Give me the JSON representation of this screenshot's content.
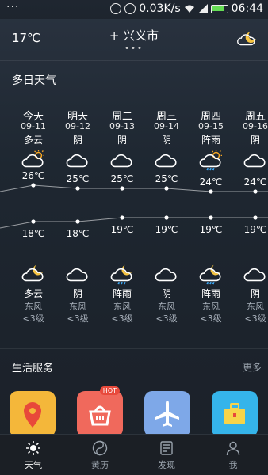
{
  "statusbar": {
    "menu_dots": "···",
    "net_speed": "0.03K/s",
    "time": "06:44"
  },
  "header": {
    "current_temp": "17℃",
    "city": "+ 兴义市",
    "page_dots": "•••"
  },
  "forecast_section": {
    "title": "多日天气"
  },
  "days": [
    {
      "name": "今天",
      "date": "09-11",
      "day_cond": "多云",
      "day_icon": "partly-cloudy-sun-icon",
      "high": "26℃",
      "low": "18℃",
      "night_icon": "cloud-moon-icon",
      "night_cond": "多云",
      "wind_dir": "东风",
      "wind_level": "<3级"
    },
    {
      "name": "明天",
      "date": "09-12",
      "day_cond": "阴",
      "day_icon": "cloud-icon",
      "high": "25℃",
      "low": "18℃",
      "night_icon": "cloud-icon",
      "night_cond": "阴",
      "wind_dir": "东风",
      "wind_level": "<3级"
    },
    {
      "name": "周二",
      "date": "09-13",
      "day_cond": "阴",
      "day_icon": "cloud-icon",
      "high": "25℃",
      "low": "19℃",
      "night_icon": "rain-moon-icon",
      "night_cond": "阵雨",
      "wind_dir": "东风",
      "wind_level": "<3级"
    },
    {
      "name": "周三",
      "date": "09-14",
      "day_cond": "阴",
      "day_icon": "cloud-icon",
      "high": "25℃",
      "low": "19℃",
      "night_icon": "cloud-icon",
      "night_cond": "阴",
      "wind_dir": "东风",
      "wind_level": "<3级"
    },
    {
      "name": "周四",
      "date": "09-15",
      "day_cond": "阵雨",
      "day_icon": "rain-sun-icon",
      "high": "24℃",
      "low": "19℃",
      "night_icon": "rain-moon-icon",
      "night_cond": "阵雨",
      "wind_dir": "东风",
      "wind_level": "<3级"
    },
    {
      "name": "周五",
      "date": "09-16",
      "day_cond": "阴",
      "day_icon": "cloud-icon",
      "high": "24℃",
      "low": "19℃",
      "night_icon": "cloud-icon",
      "night_cond": "阴",
      "wind_dir": "东风",
      "wind_level": "<3级"
    }
  ],
  "temps_high": [
    26,
    25,
    25,
    25,
    24,
    24
  ],
  "temps_low": [
    18,
    18,
    19,
    19,
    19,
    19
  ],
  "life": {
    "title": "生活服务",
    "more": "更多",
    "hot_badge": "HOT"
  },
  "services": [
    {
      "icon": "location-pin-icon",
      "color": "#f4b73a"
    },
    {
      "icon": "shopping-basket-icon",
      "color": "#f0695c"
    },
    {
      "icon": "airplane-icon",
      "color": "#7ea8e8"
    },
    {
      "icon": "briefcase-icon",
      "color": "#35b4ea"
    }
  ],
  "tabs": [
    {
      "label": "天气",
      "icon": "sun-icon",
      "active": true
    },
    {
      "label": "黄历",
      "icon": "yin-yang-icon",
      "active": false
    },
    {
      "label": "发现",
      "icon": "news-icon",
      "active": false
    },
    {
      "label": "我",
      "icon": "person-icon",
      "active": false
    }
  ],
  "colors": {
    "accent_active": "#ffffff",
    "inactive": "#9aa3ad",
    "sun": "#f5a623",
    "rain": "#3fa9f5"
  }
}
